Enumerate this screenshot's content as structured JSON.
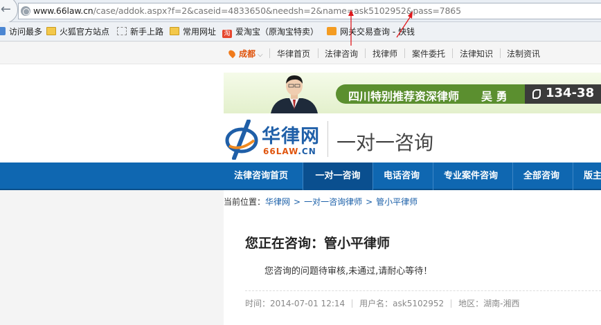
{
  "browser": {
    "url_host": "www.66law.cn",
    "url_path": "/case/addok.aspx?f=2&caseid=4833650&needsh=2&name=ask5102952&pass=7865",
    "bookmarks": [
      {
        "label": "访问最多",
        "icon": "folder-icon"
      },
      {
        "label": "火狐官方站点",
        "icon": "folder-icon"
      },
      {
        "label": "新手上路",
        "icon": "page-icon"
      },
      {
        "label": "常用网址",
        "icon": "folder-icon"
      },
      {
        "label": "爱淘宝（原淘宝特卖）",
        "icon": "taobao-icon",
        "glyph": "淘"
      },
      {
        "label": "网关交易查询 - 快钱",
        "icon": "rss-icon"
      }
    ]
  },
  "topnav": {
    "city": "成都",
    "items": [
      "华律首页",
      "法律咨询",
      "找律师",
      "案件委托",
      "法律知识",
      "法制资讯"
    ]
  },
  "banner": {
    "text": "四川特别推荐资深律师",
    "name": "吴 勇",
    "phone": "134-38"
  },
  "logo": {
    "cn": "华律网",
    "en_a": "66LAW",
    "en_b": ".CN",
    "section_title": "一对一咨询"
  },
  "mainnav": {
    "items": [
      "法律咨询首页",
      "一对一咨询",
      "电话咨询",
      "专业案件咨询",
      "全部咨询",
      "版主"
    ],
    "active_index": 1
  },
  "breadcrumb": {
    "prefix": "当前位置：",
    "items": [
      "华律网",
      "一对一咨询律师",
      "管小平律师"
    ]
  },
  "content": {
    "title": "您正在咨询：管小平律师",
    "message": "您咨询的问题待审核,未通过,请耐心等待！",
    "time_label": "时间：2014-07-01 12:14",
    "user_label": "用户名：ask5102952",
    "region_label": "地区：湖南-湘西"
  },
  "colors": {
    "nav_blue": "#0f67b1",
    "accent_orange": "#e0550e",
    "annotation_red": "#e0191d"
  }
}
